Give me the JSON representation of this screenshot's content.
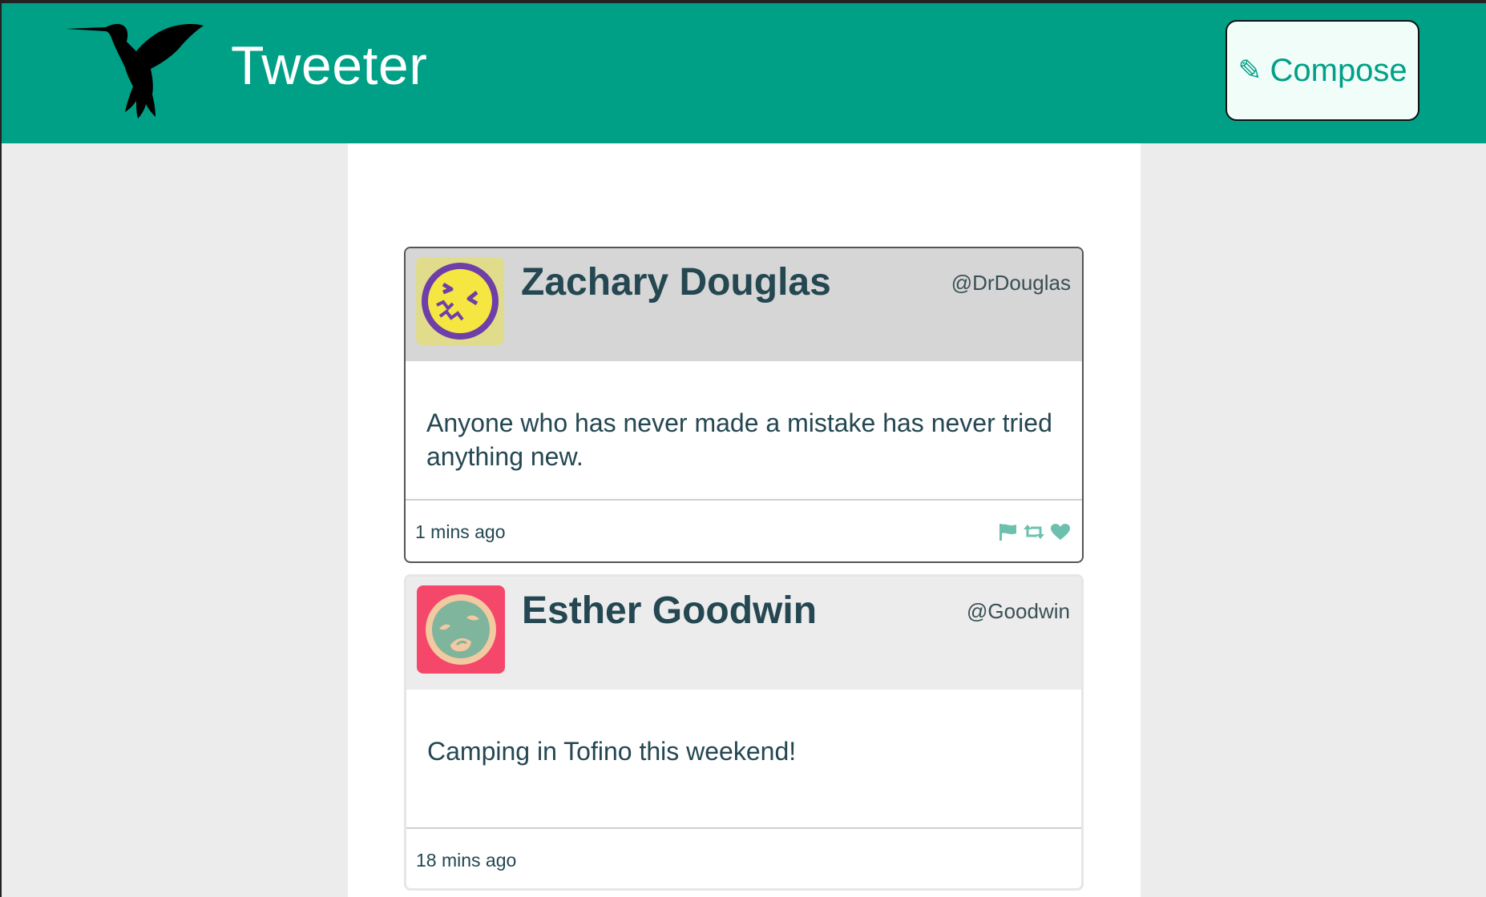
{
  "app": {
    "title": "Tweeter",
    "logo_icon": "hummingbird-logo-icon",
    "brand_color": "#00a087"
  },
  "header": {
    "compose_button": {
      "icon": "pencil-icon",
      "label": "Compose"
    }
  },
  "tweets": [
    {
      "author_name": "Zachary Douglas",
      "handle": "@DrDouglas",
      "avatar_icon": "confused-face-avatar",
      "text": "Anyone who has never made a mistake has never tried anything new.",
      "timestamp": "1 mins ago",
      "actions": [
        "flag-icon",
        "retweet-icon",
        "heart-icon"
      ]
    },
    {
      "author_name": "Esther Goodwin",
      "handle": "@Goodwin",
      "avatar_icon": "angry-face-avatar",
      "text": "Camping in Tofino this weekend!",
      "timestamp": "18 mins ago",
      "actions": []
    }
  ]
}
